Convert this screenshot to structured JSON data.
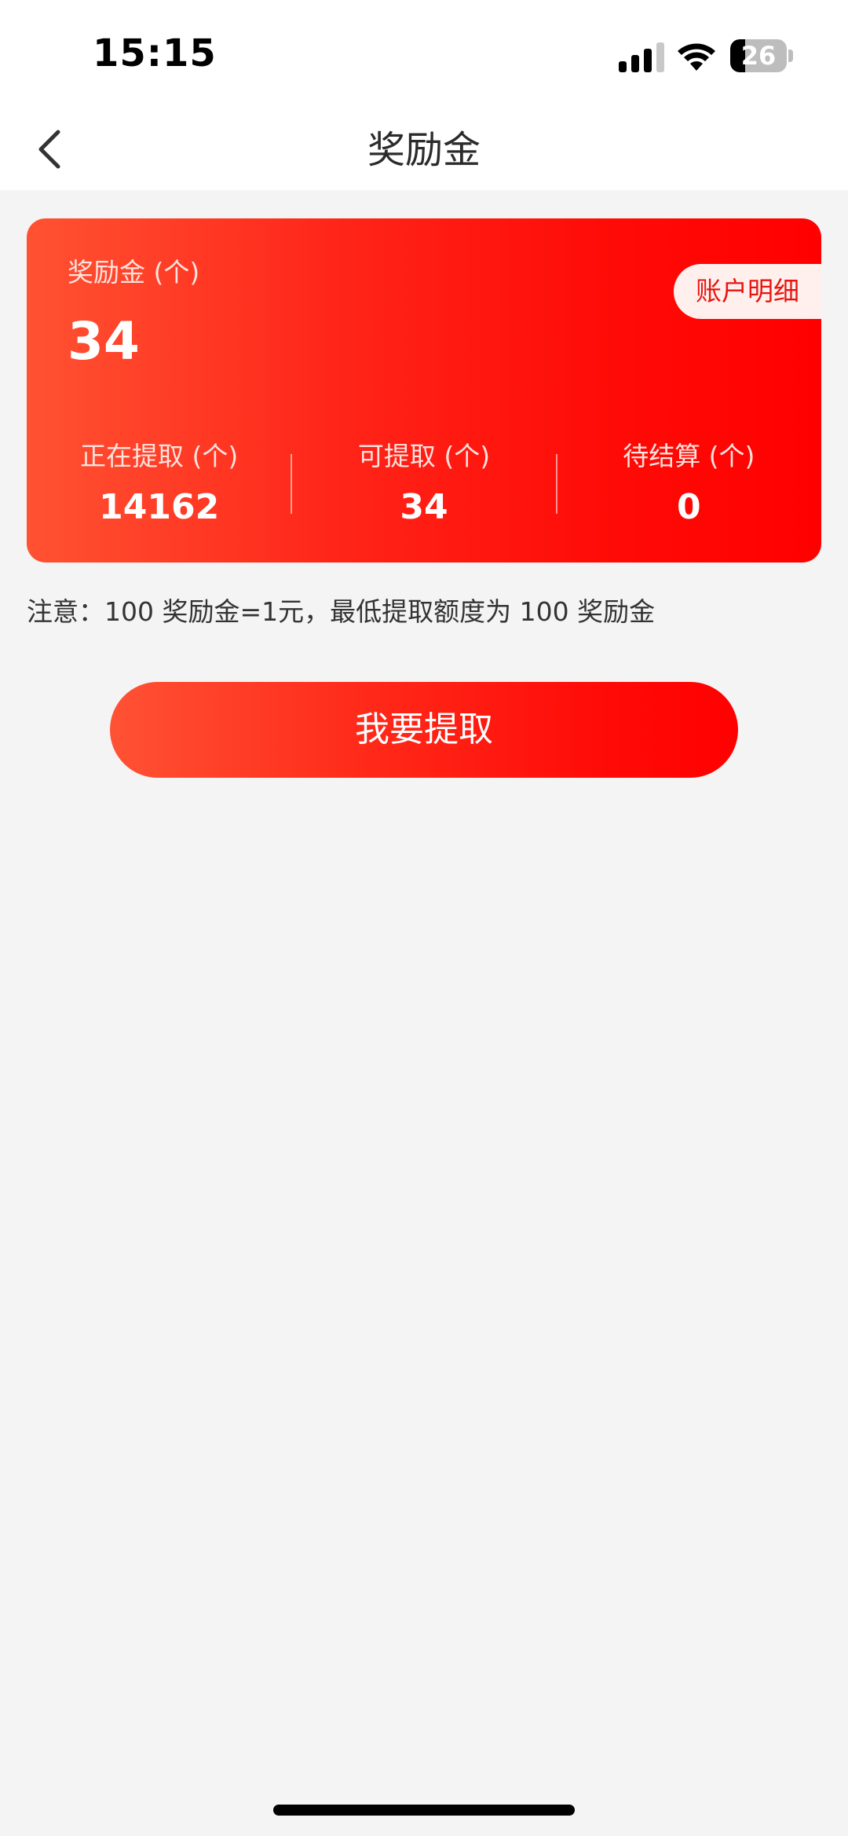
{
  "status_bar": {
    "time": "15:15",
    "battery_level": "26",
    "icons": [
      "signal-icon",
      "wifi-icon",
      "battery-icon"
    ]
  },
  "nav": {
    "title": "奖励金",
    "back_icon": "chevron-left-icon"
  },
  "card": {
    "label": "奖励金 (个)",
    "amount": "34",
    "account_detail_label": "账户明细",
    "stats": [
      {
        "label": "正在提取 (个)",
        "value": "14162"
      },
      {
        "label": "可提取 (个)",
        "value": "34"
      },
      {
        "label": "待结算 (个)",
        "value": "0"
      }
    ]
  },
  "notice": "注意：100 奖励金=1元，最低提取额度为 100 奖励金",
  "withdraw_button_label": "我要提取",
  "colors": {
    "brand_red": "#ff0000",
    "brand_orange": "#ff5232",
    "background": "#f4f4f4",
    "detail_button_bg": "#fff0ee"
  }
}
